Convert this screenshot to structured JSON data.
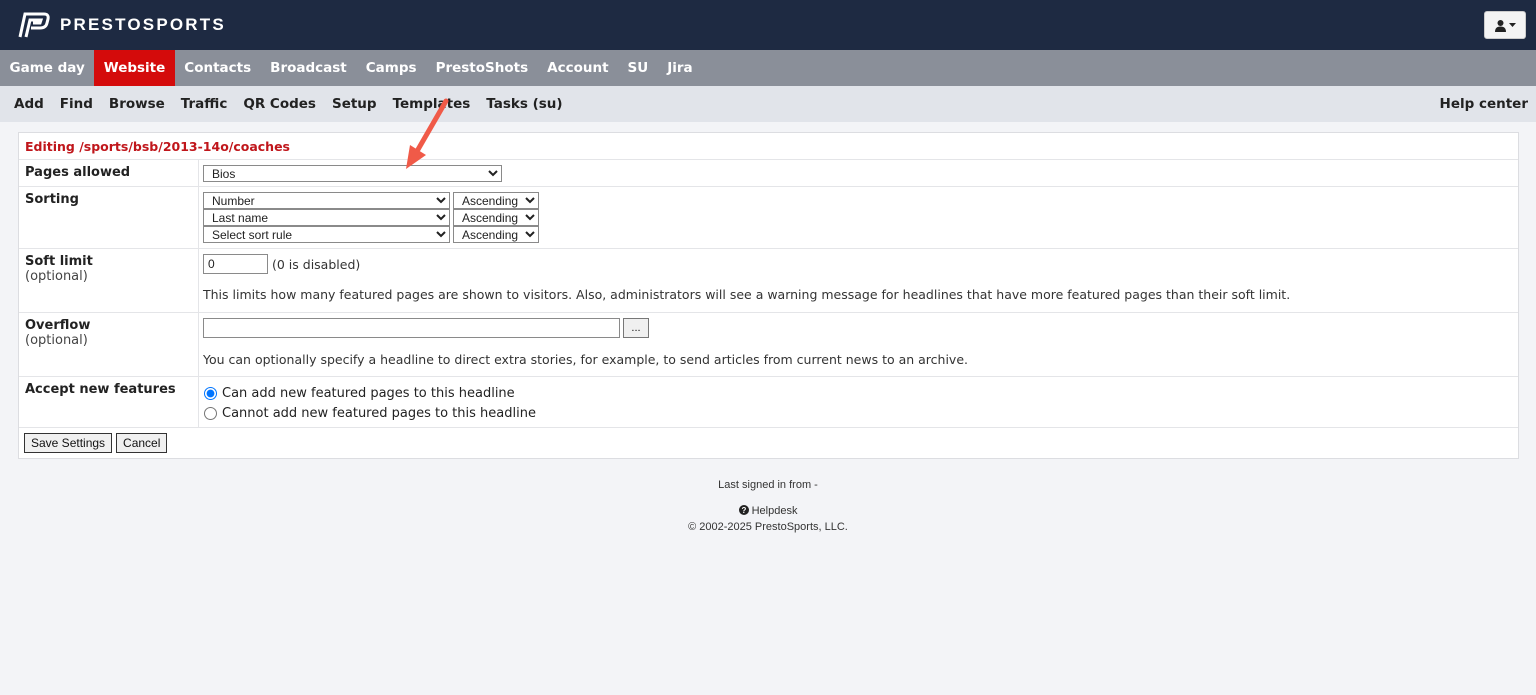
{
  "brand": {
    "name": "PRESTOSPORTS"
  },
  "main_nav": [
    {
      "label": "Game day",
      "active": false
    },
    {
      "label": "Website",
      "active": true
    },
    {
      "label": "Contacts",
      "active": false
    },
    {
      "label": "Broadcast",
      "active": false
    },
    {
      "label": "Camps",
      "active": false
    },
    {
      "label": "PrestoShots",
      "active": false
    },
    {
      "label": "Account",
      "active": false
    },
    {
      "label": "SU",
      "active": false
    },
    {
      "label": "Jira",
      "active": false
    }
  ],
  "sub_nav": [
    "Add",
    "Find",
    "Browse",
    "Traffic",
    "QR Codes",
    "Setup",
    "Templates",
    "Tasks (su)"
  ],
  "help_center": "Help center",
  "form": {
    "title": "Editing /sports/bsb/2013-14o/coaches",
    "pages_allowed": {
      "label": "Pages allowed",
      "value": "Bios"
    },
    "sorting": {
      "label": "Sorting",
      "rules": [
        {
          "rule": "Number",
          "order": "Ascending"
        },
        {
          "rule": "Last name",
          "order": "Ascending"
        },
        {
          "rule": "Select sort rule",
          "order": "Ascending"
        }
      ]
    },
    "soft_limit": {
      "label": "Soft limit",
      "optional": "(optional)",
      "value": "0",
      "note": "(0 is disabled)",
      "help": "This limits how many featured pages are shown to visitors. Also, administrators will see a warning message for headlines that have more featured pages than their soft limit."
    },
    "overflow": {
      "label": "Overflow",
      "optional": "(optional)",
      "value": "",
      "browse_label": "...",
      "help": "You can optionally specify a headline to direct extra stories, for example, to send articles from current news to an archive."
    },
    "accept_new": {
      "label": "Accept new features",
      "option_yes": "Can add new featured pages to this headline",
      "option_no": "Cannot add new featured pages to this headline",
      "selected": "yes"
    },
    "save_label": "Save Settings",
    "cancel_label": "Cancel"
  },
  "footer": {
    "last_signed": "Last signed in from -",
    "helpdesk": "Helpdesk",
    "copyright": "© 2002-2025 PrestoSports, LLC."
  },
  "colors": {
    "header_bg": "#1e2a42",
    "nav_bg": "#8a8f99",
    "nav_active": "#d40b0b",
    "subnav_bg": "#e1e4ea",
    "title_red": "#c0161b",
    "arrow": "#f05a48"
  }
}
